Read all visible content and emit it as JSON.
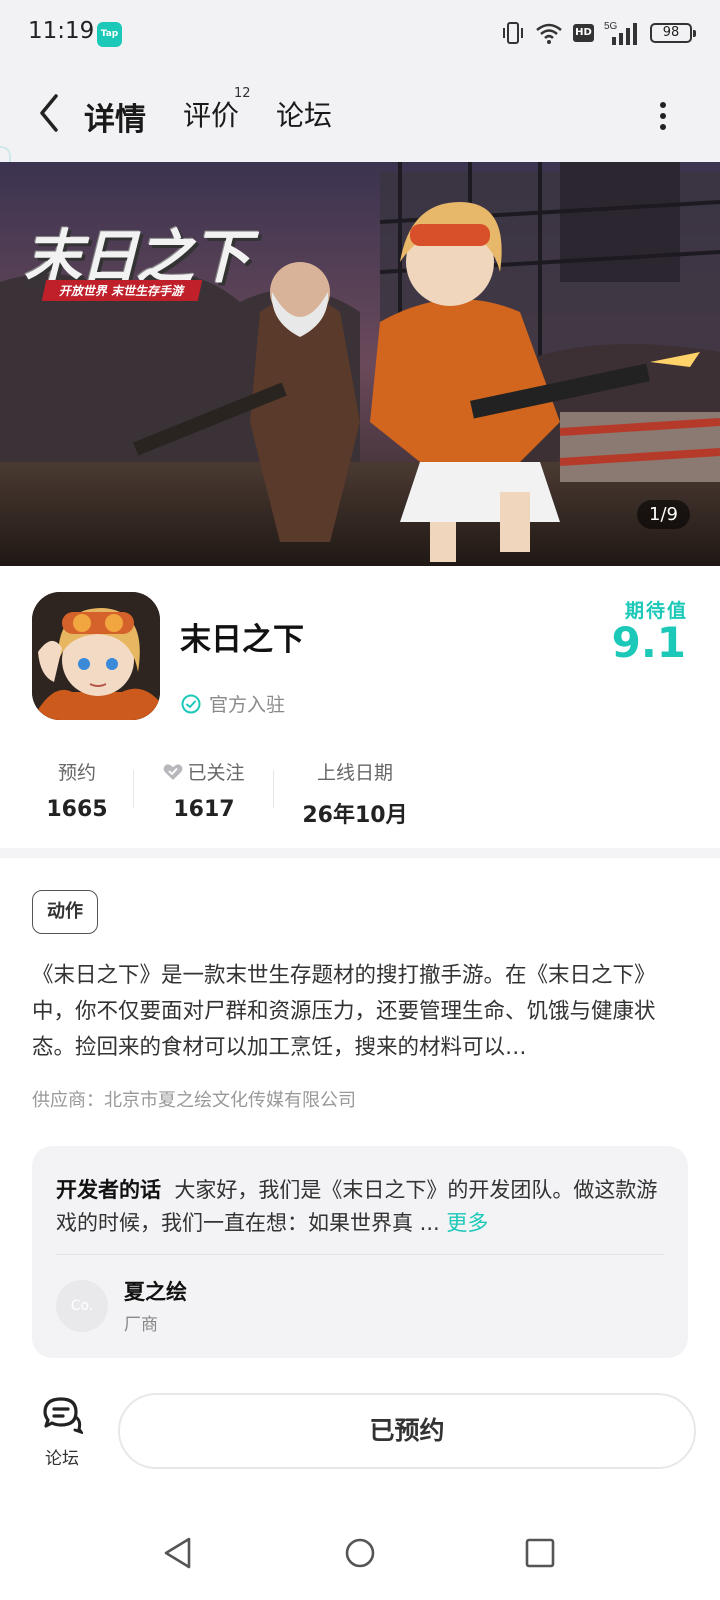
{
  "status_bar": {
    "time": "11:19",
    "app_badge": "Tap",
    "network": "5G",
    "hd": "HD",
    "battery": "98"
  },
  "nav": {
    "tabs": [
      {
        "label": "详情",
        "active": true
      },
      {
        "label": "评价",
        "badge": "12"
      },
      {
        "label": "论坛"
      }
    ],
    "back_icon": "chevron-left-icon",
    "more_icon": "more-vertical-icon"
  },
  "banner": {
    "title": "末日之下",
    "subtitle": "开放世界  末世生存手游",
    "counter": "1/9"
  },
  "app": {
    "name": "末日之下",
    "official_label": "官方入驻",
    "score_label": "期待值",
    "score": "9.1"
  },
  "stats": [
    {
      "label": "预约",
      "value": "1665"
    },
    {
      "label": "已关注",
      "value": "1617",
      "icon": "heart-icon"
    },
    {
      "label": "上线日期",
      "value": "26年10月"
    }
  ],
  "tag": "动作",
  "description": "《末日之下》是一款末世生存题材的搜打撤手游。在《末日之下》中，你不仅要面对尸群和资源压力，还要管理生命、饥饿与健康状态。捡回来的食材可以加工烹饪，搜来的材料可以…",
  "supplier": "供应商：北京市夏之绘文化传媒有限公司",
  "developer": {
    "heading": "开发者的话",
    "text": "大家好，我们是《末日之下》的开发团队。做这款游戏的时候，我们一直在想：如果世界真 ...",
    "more": "更多",
    "avatar_text": "Co.",
    "name": "夏之绘",
    "role": "厂商"
  },
  "bottom": {
    "forum_label": "论坛",
    "reserve_label": "已预约"
  },
  "colors": {
    "accent": "#1cc9b8",
    "bg_gray": "#f2f2f4"
  }
}
